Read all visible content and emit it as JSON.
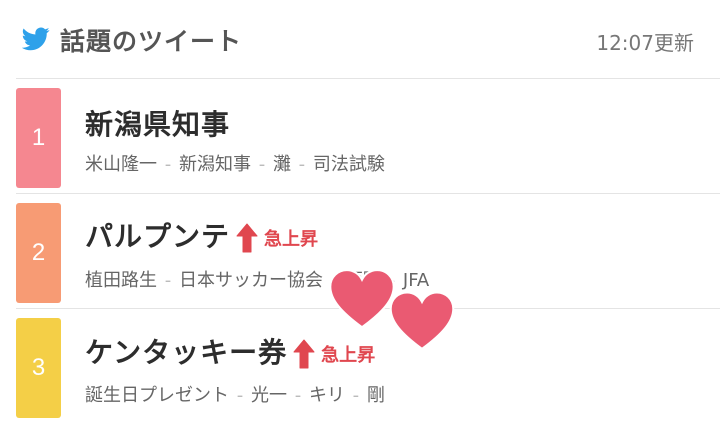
{
  "header": {
    "title": "話題のツイート",
    "updated": "12:07更新",
    "bird_icon_color": "#2ea1ea"
  },
  "colors": {
    "rank_1": "#f58790",
    "rank_2": "#f79b74",
    "rank_3": "#f4cf47",
    "rising": "#e0474f",
    "heart": "#ea5a72"
  },
  "trends": [
    {
      "rank": "1",
      "title": "新潟県知事",
      "rising": false,
      "related": [
        "米山隆一",
        "新潟知事",
        "灘",
        "司法試験"
      ]
    },
    {
      "rank": "2",
      "title": "パルプンテ",
      "rising": true,
      "rising_label": "急上昇",
      "related": [
        "植田路生",
        "日本サッカー協会",
        "西野",
        "JFA"
      ]
    },
    {
      "rank": "3",
      "title": "ケンタッキー券",
      "rising": true,
      "rising_label": "急上昇",
      "related": [
        "誕生日プレゼント",
        "光一",
        "キリ",
        "剛"
      ]
    }
  ],
  "separator": "-"
}
